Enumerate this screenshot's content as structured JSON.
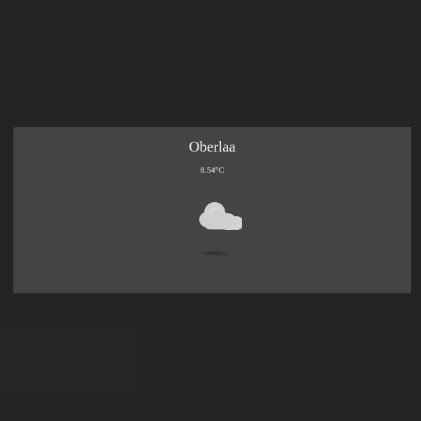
{
  "weather": {
    "city": "Oberlaa",
    "temperature": "8.54°C",
    "condition_icon": "cloud-icon"
  },
  "colors": {
    "page_bg": "#242424",
    "card_bg": "#444444",
    "text": "#f2f2f2",
    "cloud": "#cfcfcf"
  }
}
